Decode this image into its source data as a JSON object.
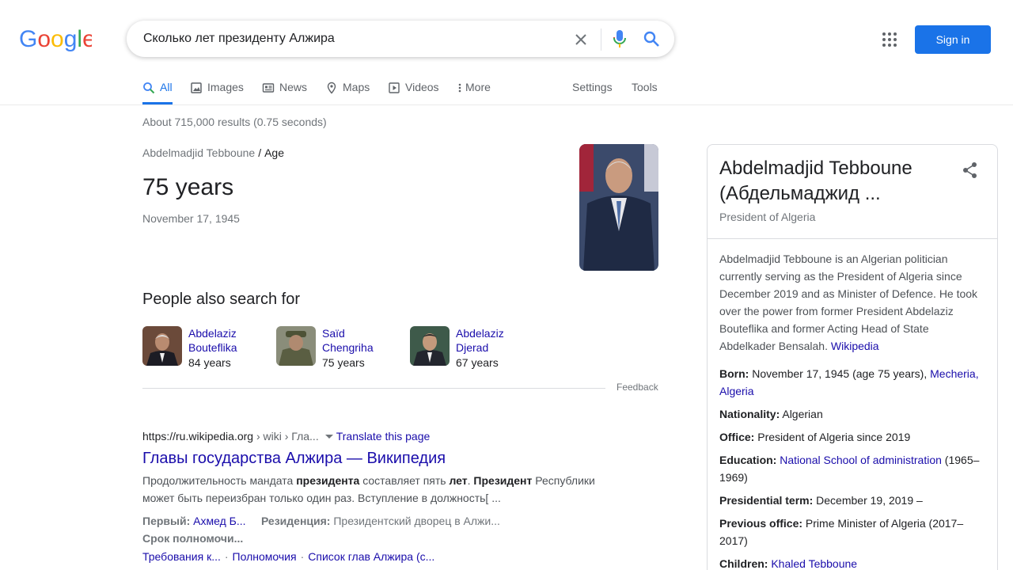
{
  "logo": {
    "text": "Google"
  },
  "search": {
    "query": "Сколько лет президенту Алжира"
  },
  "header": {
    "signin_label": "Sign in"
  },
  "tabs": [
    {
      "label": "All"
    },
    {
      "label": "Images"
    },
    {
      "label": "News"
    },
    {
      "label": "Maps"
    },
    {
      "label": "Videos"
    },
    {
      "label": "More"
    },
    {
      "label": "Settings"
    },
    {
      "label": "Tools"
    }
  ],
  "stats": "About 715,000 results (0.75 seconds)",
  "answer": {
    "crumb_entity": "Abdelmadjid Tebboune",
    "crumb_sep": "/",
    "crumb_attr": "Age",
    "value": "75 years",
    "date": "November 17, 1945"
  },
  "people": {
    "title": "People also search for",
    "items": [
      {
        "name_line1": "Abdelaziz",
        "name_line2": "Bouteflika",
        "age": "84 years"
      },
      {
        "name_line1": "Saïd",
        "name_line2": "Chengriha",
        "age": "75 years"
      },
      {
        "name_line1": "Abdelaziz",
        "name_line2": "Djerad",
        "age": "67 years"
      }
    ],
    "feedback": "Feedback"
  },
  "result": {
    "domain": "https://ru.wikipedia.org",
    "path": " › wiki › Гла...",
    "translate": "Translate this page",
    "title": "Главы государства Алжира — Википедия",
    "snippet_parts": [
      "Продолжительность мандата ",
      "президента",
      " составляет пять ",
      "лет",
      ". ",
      "Президент",
      " Республики может быть переизбран только один раз. Вступление в должность[ ..."
    ],
    "meta1_label": "Первый:",
    "meta1_value": "Ахмед Б...",
    "meta2_label": "Резиденция:",
    "meta2_value": "Президентский дворец в Алжи...",
    "meta3": "Срок полномочи...",
    "sitelinks": [
      "Требования к...",
      "Полномочия",
      "Список глав Алжира (с..."
    ],
    "sitelink_sep": "·"
  },
  "knowledge_panel": {
    "title": "Abdelmadjid Tebboune (Абдельмаджид ...",
    "subtitle": "President of Algeria",
    "description": "Abdelmadjid Tebboune is an Algerian politician currently serving as the President of Algeria since December 2019 and as Minister of Defence. He took over the power from former President Abdelaziz Bouteflika and former Acting Head of State Abdelkader Bensalah.",
    "description_link": "Wikipedia",
    "facts": {
      "born_label": "Born:",
      "born_text": "November 17, 1945 (age 75 years),",
      "born_link": "Mecheria, Algeria",
      "nationality_label": "Nationality:",
      "nationality_text": "Algerian",
      "office_label": "Office:",
      "office_text": "President of Algeria since 2019",
      "education_label": "Education:",
      "education_link": "National School of administration",
      "education_text": "(1965–1969)",
      "term_label": "Presidential term:",
      "term_text": "December 19, 2019 –",
      "prev_label": "Previous office:",
      "prev_text": "Prime Minister of Algeria (2017–2017)",
      "children_label": "Children:",
      "children_link": "Khaled Tebboune"
    }
  },
  "colors": {
    "accent": "#1a73e8",
    "link": "#1a0dab",
    "muted": "#70757a"
  }
}
